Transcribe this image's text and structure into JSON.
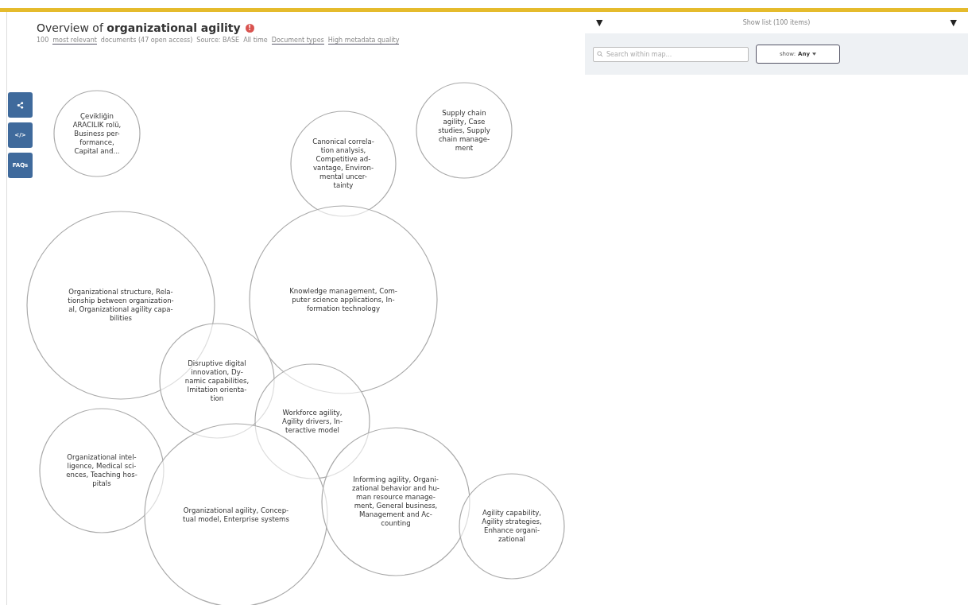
{
  "header": {
    "title_prefix": "Overview of",
    "title_query": "organizational agility",
    "info_badge": "!",
    "subtitle": [
      {
        "kind": "text",
        "text": "100"
      },
      {
        "kind": "link",
        "text": "most relevant"
      },
      {
        "kind": "text",
        "text": "documents (47 open access)"
      },
      {
        "kind": "text",
        "text": "Source: BASE"
      },
      {
        "kind": "text",
        "text": "All time"
      },
      {
        "kind": "link",
        "text": "Document types"
      },
      {
        "kind": "link",
        "text": "High metadata quality"
      }
    ]
  },
  "side_buttons": [
    {
      "kind": "share"
    },
    {
      "kind": "embed",
      "text": "</>"
    },
    {
      "kind": "text",
      "text": "FAQs"
    }
  ],
  "list_panel": {
    "toggle_left": "▼",
    "title": "Show list (100 items)",
    "toggle_right": "▼",
    "search": {
      "placeholder": "Search within map..."
    },
    "filter": {
      "label": "show:",
      "value": "Any"
    }
  },
  "bubbles": [
    {
      "label": "Çevikliğin\nARACILIK rolü,\nBusiness per-\nformance,\nCapital and..."
    },
    {
      "label": "Supply chain\nagility, Case\nstudies, Supply\nchain manage-\nment"
    },
    {
      "label": "Canonical correla-\ntion analysis,\nCompetitive ad-\nvantage, Environ-\nmental uncer-\ntainty"
    },
    {
      "label": "Organizational structure, Rela-\ntionship between organization-\nal, Organizational agility capa-\nbilities"
    },
    {
      "label": "Knowledge management, Com-\nputer science applications, In-\nformation technology"
    },
    {
      "label": "Disruptive digital\ninnovation, Dy-\nnamic capabilities,\nImitation orienta-\ntion"
    },
    {
      "label": "Workforce agility,\nAgility drivers, In-\nteractive model"
    },
    {
      "label": "Organizational intel-\nligence, Medical sci-\nences, Teaching hos-\npitals"
    },
    {
      "label": "Organizational agility, Concep-\ntual model, Enterprise systems"
    },
    {
      "label": "Informing agility, Organi-\nzational behavior and hu-\nman resource manage-\nment, General business,\nManagement and Ac-\ncounting"
    },
    {
      "label": "Agility capability,\nAgility strategies,\nEnhance organi-\nzational"
    }
  ]
}
